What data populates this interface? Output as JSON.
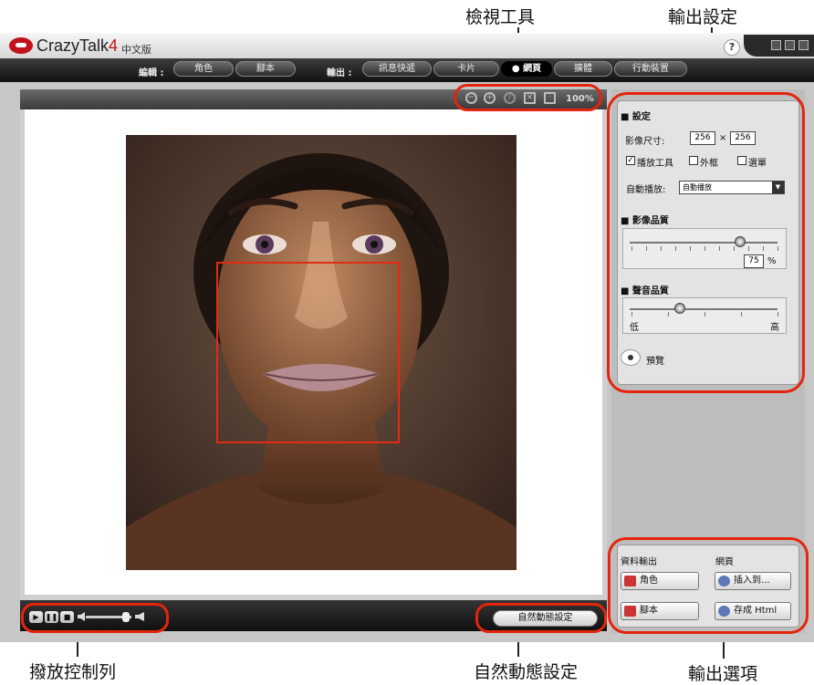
{
  "callouts": {
    "view_tools": "檢視工具",
    "output_settings": "輸出設定",
    "playback_bar": "撥放控制列",
    "natural_motion": "自然動態設定",
    "output_options": "輸出選項"
  },
  "app": {
    "title": "CrazyTalk",
    "version": "4",
    "edition": "中文版",
    "help": "?"
  },
  "toolbar": {
    "edit_label": "編輯 :",
    "edit_tabs": [
      "角色",
      "腳本"
    ],
    "output_label": "輸出 :",
    "output_tabs": [
      "訊息快遞",
      "卡片",
      "● 網頁",
      "擴體",
      "行動裝置"
    ],
    "active_output_tab": "● 網頁"
  },
  "view": {
    "zoom": "100%",
    "icons": [
      "zoom-out-icon",
      "zoom-in-icon",
      "disabled-icon",
      "fit-icon",
      "actual-size-icon"
    ]
  },
  "playback": {
    "buttons": [
      "▶",
      "❚❚",
      "■"
    ]
  },
  "natural_motion_button": "自然動態設定",
  "settings": {
    "header": "■ 設定",
    "image_size_label": "影像尺寸:",
    "width": "256",
    "times": "×",
    "height": "256",
    "checkboxes": [
      {
        "label": "播放工具",
        "checked": true
      },
      {
        "label": "外框",
        "checked": false
      },
      {
        "label": "選單",
        "checked": false
      }
    ],
    "autoplay_label": "自動播放:",
    "autoplay_value": "自動播放",
    "image_quality_header": "■ 影像品質",
    "image_quality_value": "75",
    "image_quality_unit": "%",
    "audio_quality_header": "■ 聲音品質",
    "audio_low": "低",
    "audio_high": "高",
    "audio_quality_level": 0.35,
    "preview_label": "預覽"
  },
  "outputs": {
    "data_header": "資料輸出",
    "web_header": "網頁",
    "character_button": "角色",
    "script_button": "腳本",
    "insert_button": "插入到...",
    "save_html_button": "存成 Html"
  },
  "colors": {
    "highlight_ring": "#e4250b",
    "brand_red": "#c1121b"
  }
}
